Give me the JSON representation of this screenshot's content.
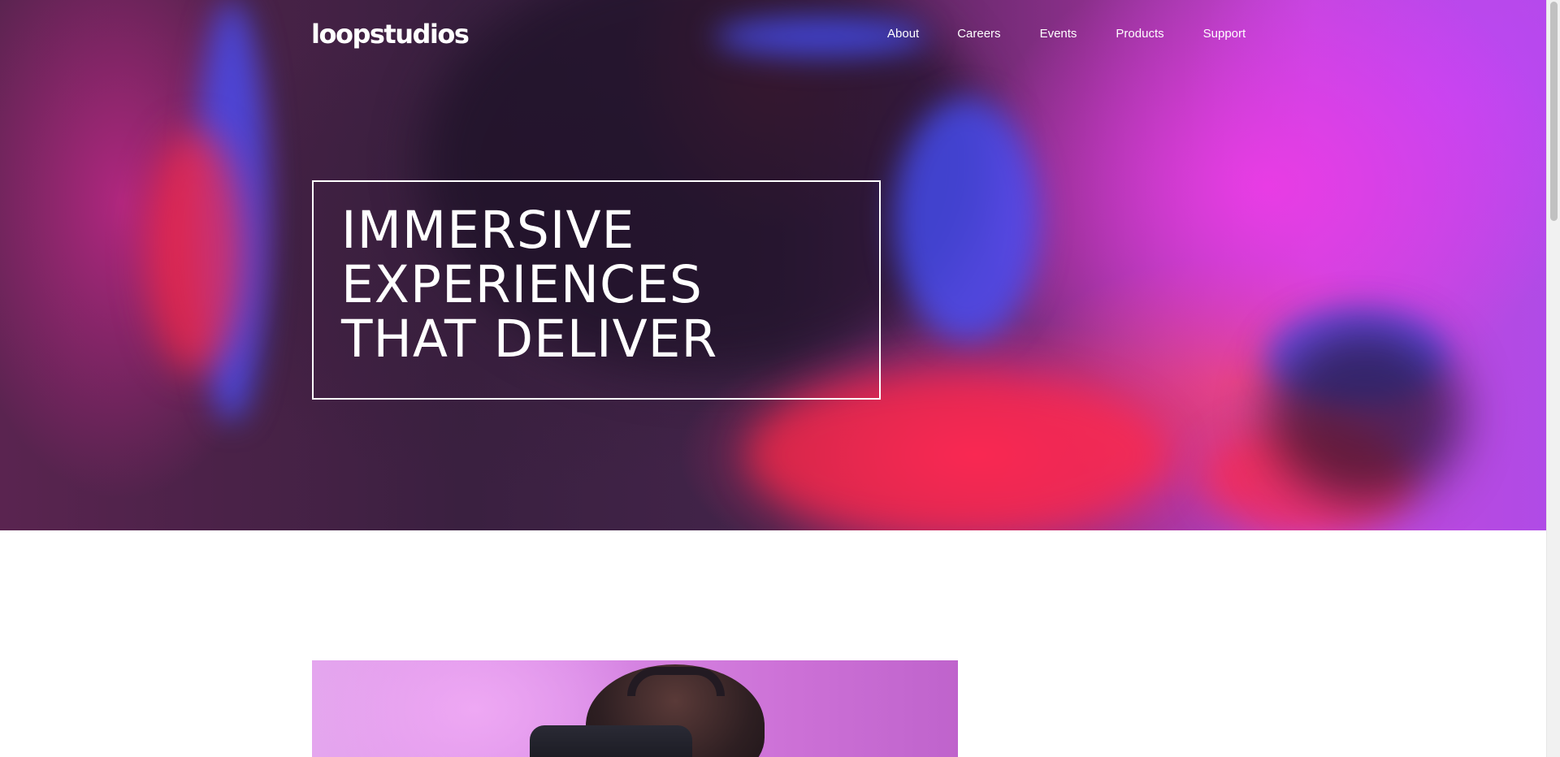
{
  "brand": {
    "logo": "loopstudios"
  },
  "nav": {
    "items": [
      {
        "label": "About"
      },
      {
        "label": "Careers"
      },
      {
        "label": "Events"
      },
      {
        "label": "Products"
      },
      {
        "label": "Support"
      }
    ]
  },
  "hero": {
    "headline_lines": [
      "IMMERSIVE",
      "EXPERIENCES",
      "THAT DELIVER"
    ]
  },
  "colors": {
    "text_on_hero": "#ffffff",
    "page_background": "#ffffff",
    "accent_magenta": "#d94be8"
  },
  "icons": {
    "hero_image": "vr-user-photo",
    "intro_image": "man-with-vr-headset-photo"
  }
}
